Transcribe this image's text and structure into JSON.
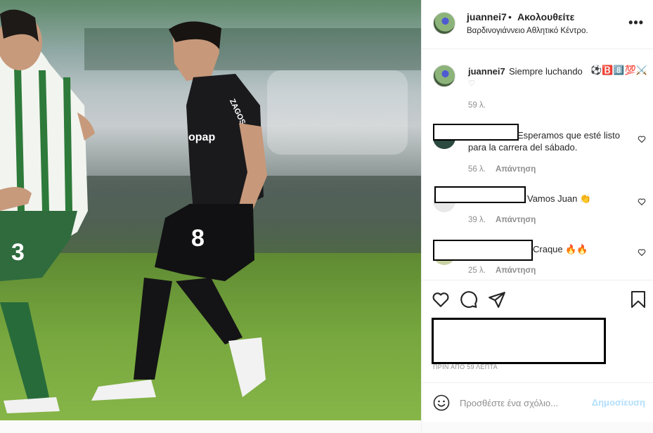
{
  "post": {
    "username": "juannei7",
    "separator": "•",
    "follow_label": "Ακολουθείτε",
    "location": "Βαρδινογιάννειο Αθλητικό Κέντρο.",
    "more_label": "•••",
    "caption_text": "Siempre luchando",
    "caption_emojis": "⚽🅱️8️⃣💯⚔️",
    "caption_age": "59 λ.",
    "time_ago": "ΠΡΙΝ ΑΠΟ 59 ΛΕΠΤΑ",
    "photo_texts": {
      "shirt_number": "8",
      "sponsor": "opap",
      "sleeve": "ZAGOS",
      "opponent_number": "3"
    }
  },
  "comments": [
    {
      "text": "Esperamos que esté listo para la carrera del sábado.",
      "age": "56 λ.",
      "reply_label": "Απάντηση"
    },
    {
      "text": "Vamos Juan 👏",
      "age": "39 λ.",
      "reply_label": "Απάντηση"
    },
    {
      "text": "Craque 🔥🔥",
      "age": "25 λ.",
      "reply_label": "Απάντηση"
    }
  ],
  "add_comment": {
    "placeholder": "Προσθέστε ένα σχόλιο...",
    "post_label": "Δημοσίευση"
  },
  "colors": {
    "post_button_disabled": "#b2dffc",
    "meta_gray": "#8e8e8e",
    "text": "#262626"
  },
  "icons": [
    "more-icon",
    "heart-icon",
    "comment-icon",
    "share-icon",
    "bookmark-icon",
    "emoji-icon"
  ]
}
